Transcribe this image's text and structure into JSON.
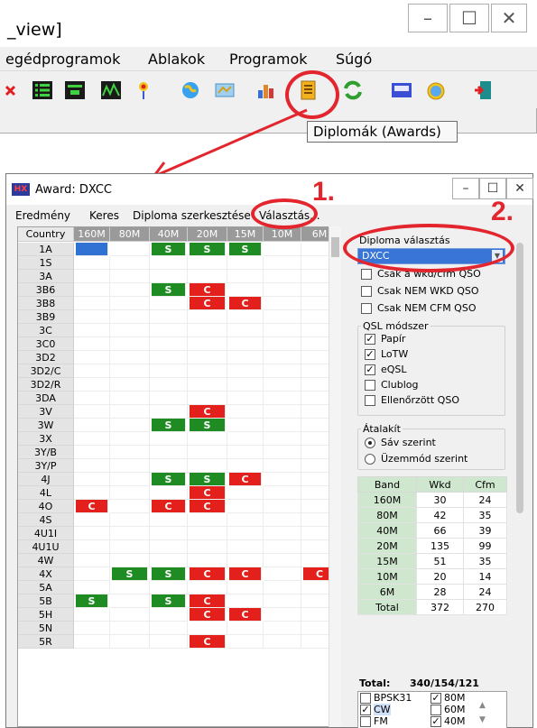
{
  "top_window": {
    "title_fragment": "_view]",
    "menu": [
      "egédprogramok",
      "Ablakok",
      "Programok",
      "Súgó"
    ],
    "tooltip": "Diplomák (Awards)",
    "buttons": {
      "minimize": "–",
      "maximize": "☐",
      "close": "✕"
    }
  },
  "award_window": {
    "app_icon": "HX",
    "title": "Award: DXCC",
    "menu": [
      "Eredmény",
      "Keres",
      "Diploma szerkesztése",
      "Választás..."
    ],
    "buttons": {
      "minimize": "–",
      "maximize": "☐",
      "close": "✕"
    }
  },
  "grid": {
    "country_header": "Country",
    "bands": [
      "160M",
      "80M",
      "40M",
      "20M",
      "15M",
      "10M",
      "6M"
    ],
    "rows": [
      {
        "country": "1A",
        "cells": [
          "B",
          "",
          "S",
          "S",
          "S",
          "",
          ""
        ]
      },
      {
        "country": "1S",
        "cells": [
          "",
          "",
          "",
          "",
          "",
          "",
          ""
        ]
      },
      {
        "country": "3A",
        "cells": [
          "",
          "",
          "",
          "",
          "",
          "",
          ""
        ]
      },
      {
        "country": "3B6",
        "cells": [
          "",
          "",
          "S",
          "C",
          "",
          "",
          ""
        ]
      },
      {
        "country": "3B8",
        "cells": [
          "",
          "",
          "",
          "C",
          "C",
          "",
          ""
        ]
      },
      {
        "country": "3B9",
        "cells": [
          "",
          "",
          "",
          "",
          "",
          "",
          ""
        ]
      },
      {
        "country": "3C",
        "cells": [
          "",
          "",
          "",
          "",
          "",
          "",
          ""
        ]
      },
      {
        "country": "3C0",
        "cells": [
          "",
          "",
          "",
          "",
          "",
          "",
          ""
        ]
      },
      {
        "country": "3D2",
        "cells": [
          "",
          "",
          "",
          "",
          "",
          "",
          ""
        ]
      },
      {
        "country": "3D2/C",
        "cells": [
          "",
          "",
          "",
          "",
          "",
          "",
          ""
        ]
      },
      {
        "country": "3D2/R",
        "cells": [
          "",
          "",
          "",
          "",
          "",
          "",
          ""
        ]
      },
      {
        "country": "3DA",
        "cells": [
          "",
          "",
          "",
          "",
          "",
          "",
          ""
        ]
      },
      {
        "country": "3V",
        "cells": [
          "",
          "",
          "",
          "C",
          "",
          "",
          ""
        ]
      },
      {
        "country": "3W",
        "cells": [
          "",
          "",
          "S",
          "S",
          "",
          "",
          ""
        ]
      },
      {
        "country": "3X",
        "cells": [
          "",
          "",
          "",
          "",
          "",
          "",
          ""
        ]
      },
      {
        "country": "3Y/B",
        "cells": [
          "",
          "",
          "",
          "",
          "",
          "",
          ""
        ]
      },
      {
        "country": "3Y/P",
        "cells": [
          "",
          "",
          "",
          "",
          "",
          "",
          ""
        ]
      },
      {
        "country": "4J",
        "cells": [
          "",
          "",
          "S",
          "S",
          "C",
          "",
          ""
        ]
      },
      {
        "country": "4L",
        "cells": [
          "",
          "",
          "",
          "C",
          "",
          "",
          ""
        ]
      },
      {
        "country": "4O",
        "cells": [
          "C",
          "",
          "C",
          "C",
          "",
          "",
          ""
        ]
      },
      {
        "country": "4S",
        "cells": [
          "",
          "",
          "",
          "",
          "",
          "",
          ""
        ]
      },
      {
        "country": "4U1I",
        "cells": [
          "",
          "",
          "",
          "",
          "",
          "",
          ""
        ]
      },
      {
        "country": "4U1U",
        "cells": [
          "",
          "",
          "",
          "",
          "",
          "",
          ""
        ]
      },
      {
        "country": "4W",
        "cells": [
          "",
          "",
          "",
          "",
          "",
          "",
          ""
        ]
      },
      {
        "country": "4X",
        "cells": [
          "",
          "S",
          "S",
          "C",
          "C",
          "",
          "C"
        ]
      },
      {
        "country": "5A",
        "cells": [
          "",
          "",
          "",
          "",
          "",
          "",
          ""
        ]
      },
      {
        "country": "5B",
        "cells": [
          "S",
          "",
          "S",
          "C",
          "",
          "",
          ""
        ]
      },
      {
        "country": "5H",
        "cells": [
          "",
          "",
          "",
          "C",
          "C",
          "",
          ""
        ]
      },
      {
        "country": "5N",
        "cells": [
          "",
          "",
          "",
          "",
          "",
          "",
          ""
        ]
      },
      {
        "country": "5R",
        "cells": [
          "",
          "",
          "",
          "C",
          "",
          "",
          ""
        ]
      }
    ]
  },
  "right_panel": {
    "diploma_label": "Diploma választás",
    "diploma_value": "DXCC",
    "filters": [
      {
        "label": "Csak a wkd/cfm QSO",
        "checked": false
      },
      {
        "label": "Csak NEM WKD QSO",
        "checked": false
      },
      {
        "label": "Csak NEM CFM QSO",
        "checked": false
      }
    ],
    "qsl_group_label": "QSL módszer",
    "qsl_methods": [
      {
        "label": "Papír",
        "checked": true
      },
      {
        "label": "LoTW",
        "checked": true
      },
      {
        "label": "eQSL",
        "checked": true
      },
      {
        "label": "Clublog",
        "checked": false
      },
      {
        "label": "Ellenőrzött QSO",
        "checked": false
      }
    ],
    "convert_group_label": "Átalakít",
    "convert_options": [
      {
        "label": "Sáv szerint",
        "selected": true
      },
      {
        "label": "Üzemmód szerint",
        "selected": false
      }
    ],
    "band_table": {
      "headers": [
        "Band",
        "Wkd",
        "Cfm"
      ],
      "rows": [
        [
          "160M",
          "30",
          "24"
        ],
        [
          "80M",
          "42",
          "35"
        ],
        [
          "40M",
          "66",
          "39"
        ],
        [
          "20M",
          "135",
          "99"
        ],
        [
          "15M",
          "51",
          "35"
        ],
        [
          "10M",
          "20",
          "14"
        ],
        [
          "6M",
          "28",
          "24"
        ],
        [
          "Total",
          "372",
          "270"
        ]
      ]
    },
    "total_label": "Total:",
    "total_value": "340/154/121",
    "modes": [
      {
        "label": "BPSK31",
        "checked": false
      },
      {
        "label": "CW",
        "checked": true
      },
      {
        "label": "FM",
        "checked": false
      }
    ],
    "mode_bands": [
      {
        "label": "80M",
        "checked": true
      },
      {
        "label": "60M",
        "checked": false
      },
      {
        "label": "40M",
        "checked": true
      }
    ]
  },
  "annotations": {
    "step1": "1.",
    "step2": "2.",
    "color": "#e3262e"
  }
}
